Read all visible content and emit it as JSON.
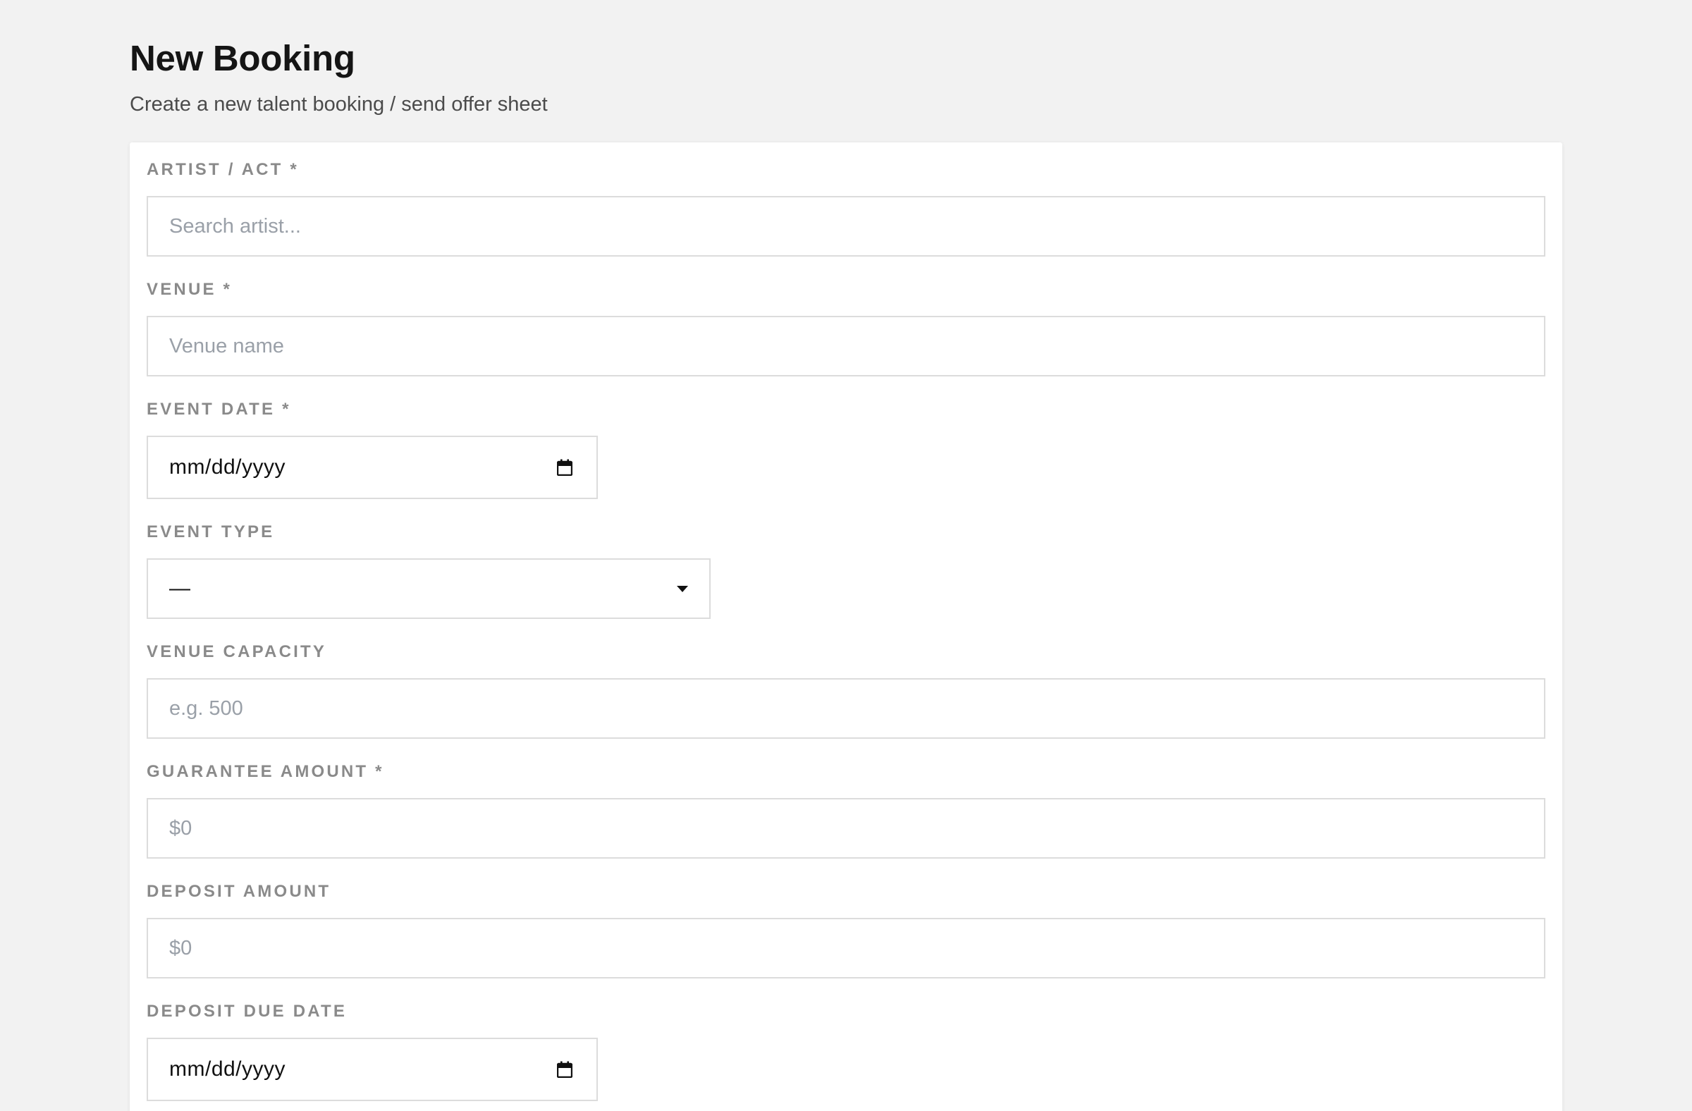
{
  "page": {
    "title": "New Booking",
    "subtitle": "Create a new talent booking / send offer sheet"
  },
  "form": {
    "artist": {
      "label": "ARTIST / ACT *",
      "placeholder": "Search artist..."
    },
    "venue": {
      "label": "VENUE *",
      "placeholder": "Venue name"
    },
    "event_date": {
      "label": "EVENT DATE *",
      "value": "mm/dd/yyyy",
      "icon": "calendar-icon"
    },
    "event_type": {
      "label": "EVENT TYPE",
      "selected": "—",
      "icon": "chevron-down-icon"
    },
    "venue_capacity": {
      "label": "VENUE CAPACITY",
      "placeholder": "e.g. 500"
    },
    "guarantee_amount": {
      "label": "GUARANTEE AMOUNT *",
      "placeholder": "$0"
    },
    "deposit_amount": {
      "label": "DEPOSIT AMOUNT",
      "placeholder": "$0"
    },
    "deposit_due_date": {
      "label": "DEPOSIT DUE DATE",
      "value": "mm/dd/yyyy",
      "icon": "calendar-icon"
    }
  },
  "colors": {
    "background": "#f2f2f2",
    "card": "#ffffff",
    "label": "#8a8a8a",
    "border": "#dcdcdc",
    "placeholder": "#9aa0a8"
  }
}
